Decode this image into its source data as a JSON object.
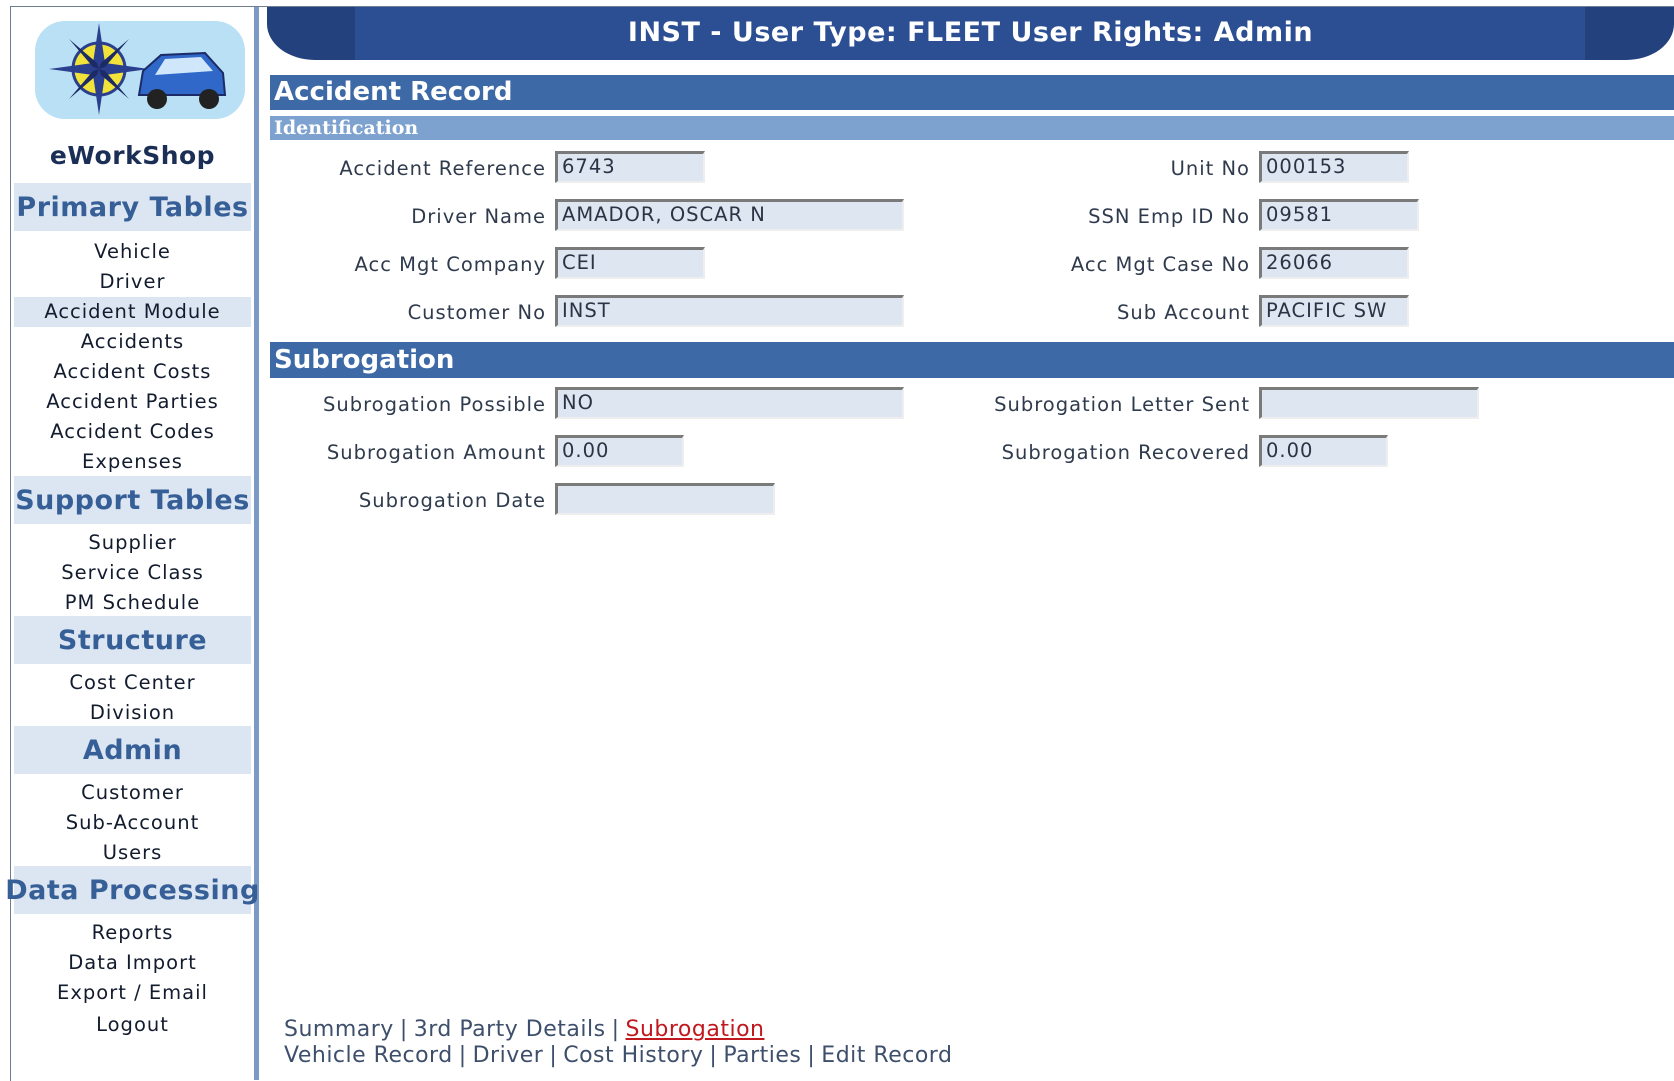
{
  "header": {
    "title": "INST - User Type: FLEET User Rights: Admin"
  },
  "app": {
    "name": "eWorkShop",
    "logo_icon": "compass-car-logo"
  },
  "sidebar": {
    "sections": [
      {
        "title": "Primary Tables",
        "items": [
          "Vehicle",
          "Driver",
          "Accident Module",
          "Accidents",
          "Accident Costs",
          "Accident Parties",
          "Accident Codes",
          "Expenses"
        ]
      },
      {
        "title": "Support Tables",
        "items": [
          "Supplier",
          "Service Class",
          "PM Schedule"
        ]
      },
      {
        "title": "Structure",
        "items": [
          "Cost Center",
          "Division"
        ]
      },
      {
        "title": "Admin",
        "items": [
          "Customer",
          "Sub-Account",
          "Users"
        ]
      },
      {
        "title": "Data Processing",
        "items": [
          "Reports",
          "Data Import",
          "Export / Email",
          "Logout"
        ]
      }
    ]
  },
  "page": {
    "title": "Accident Record",
    "identification_title": "Identification",
    "identification": {
      "accident_reference": {
        "label": "Accident Reference",
        "value": "6743"
      },
      "driver_name": {
        "label": "Driver Name",
        "value": "AMADOR, OSCAR N"
      },
      "acc_mgt_company": {
        "label": "Acc Mgt Company",
        "value": "CEI"
      },
      "customer_no": {
        "label": "Customer No",
        "value": "INST"
      },
      "unit_no": {
        "label": "Unit No",
        "value": "000153"
      },
      "ssn_emp_id": {
        "label": "SSN Emp ID No",
        "value": "09581"
      },
      "acc_mgt_case_no": {
        "label": "Acc Mgt Case No",
        "value": "26066"
      },
      "sub_account": {
        "label": "Sub Account",
        "value": "PACIFIC SW"
      }
    },
    "subrogation_title": "Subrogation",
    "subrogation": {
      "possible": {
        "label": "Subrogation Possible",
        "value": "NO"
      },
      "amount": {
        "label": "Subrogation Amount",
        "value": "0.00"
      },
      "date": {
        "label": "Subrogation Date",
        "value": ""
      },
      "letter_sent": {
        "label": "Subrogation Letter Sent",
        "value": ""
      },
      "recovered": {
        "label": "Subrogation Recovered",
        "value": "0.00"
      }
    }
  },
  "links": {
    "row1": [
      "Summary",
      "3rd Party Details",
      "Subrogation"
    ],
    "row2": [
      "Vehicle Record",
      "Driver",
      "Cost History",
      "Parties",
      "Edit Record"
    ],
    "separator": "|"
  },
  "colors": {
    "header": "#2c4f93",
    "section_bar": "#3d6aa6",
    "sub_bar": "#7ea2cf",
    "nav_highlight": "#dce6f2",
    "current_link": "#c0181e"
  }
}
